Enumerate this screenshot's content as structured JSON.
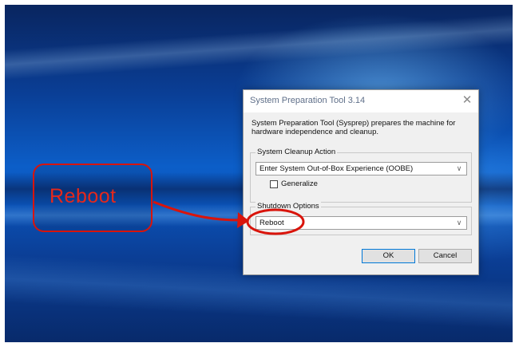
{
  "dialog": {
    "title": "System Preparation Tool 3.14",
    "close_glyph": "✕",
    "description": "System Preparation Tool (Sysprep) prepares the machine for hardware independence and cleanup.",
    "cleanup_group": {
      "label": "System Cleanup Action",
      "selected": "Enter System Out-of-Box Experience (OOBE)",
      "generalize_label": "Generalize",
      "generalize_checked": false
    },
    "shutdown_group": {
      "label": "Shutdown Options",
      "selected": "Reboot"
    },
    "buttons": {
      "ok": "OK",
      "cancel": "Cancel"
    }
  },
  "annotation": {
    "callout_text": "Reboot",
    "color": "#e5281b"
  },
  "icons": {
    "dropdown": "chevron-down-icon",
    "close": "close-icon"
  }
}
